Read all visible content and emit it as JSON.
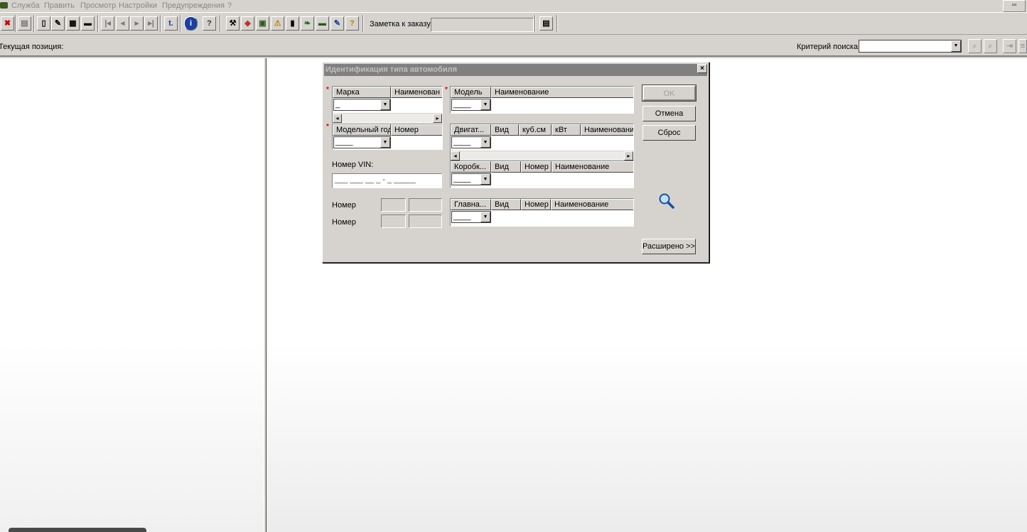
{
  "menu": {
    "items": [
      "Служба",
      "Править",
      "Просмотр",
      "Настройки",
      "Предупреждения",
      "?"
    ]
  },
  "toolbar": {
    "note_label": "Заметка к заказу:",
    "note_value": "",
    "glyphs": {
      "info": "i",
      "help": "?",
      "t": "t."
    }
  },
  "status": {
    "current_position_label": "Текущая позиция:",
    "search_label": "Критерий поиска:",
    "search_value": ""
  },
  "dialog": {
    "title": "Идентификация типа автомобиля",
    "close_glyph": "×",
    "make_grid": {
      "headers": [
        "Марка",
        "Наименован"
      ],
      "value": "_"
    },
    "model_grid": {
      "headers": [
        "Модель",
        "Наименование"
      ],
      "value": "____"
    },
    "year_grid": {
      "headers": [
        "Модельный год",
        "Номер"
      ],
      "value": "____"
    },
    "engine_grid": {
      "headers": [
        "Двигат...",
        "Вид",
        "куб.см",
        "кВт",
        "Наименование"
      ],
      "value": "____"
    },
    "gearbox_grid": {
      "headers": [
        "Коробк...",
        "Вид",
        "Номер",
        "Наименование"
      ],
      "value": "____"
    },
    "axle_grid": {
      "headers": [
        "Главна...",
        "Вид",
        "Номер",
        "Наименование"
      ],
      "value": "____"
    },
    "vin_label": "Номер VIN:",
    "vin_value": "___ ___ __ _ - _ _____",
    "number_label_1": "Номер",
    "number_label_2": "Номер",
    "buttons": {
      "ok": "OK",
      "cancel": "Отмена",
      "reset": "Сброс",
      "extended": "Расширено >>"
    }
  },
  "colors": {
    "window_bg": "#d6d3ce",
    "required_marker": "#dd0000",
    "title_inactive": "#808080"
  }
}
